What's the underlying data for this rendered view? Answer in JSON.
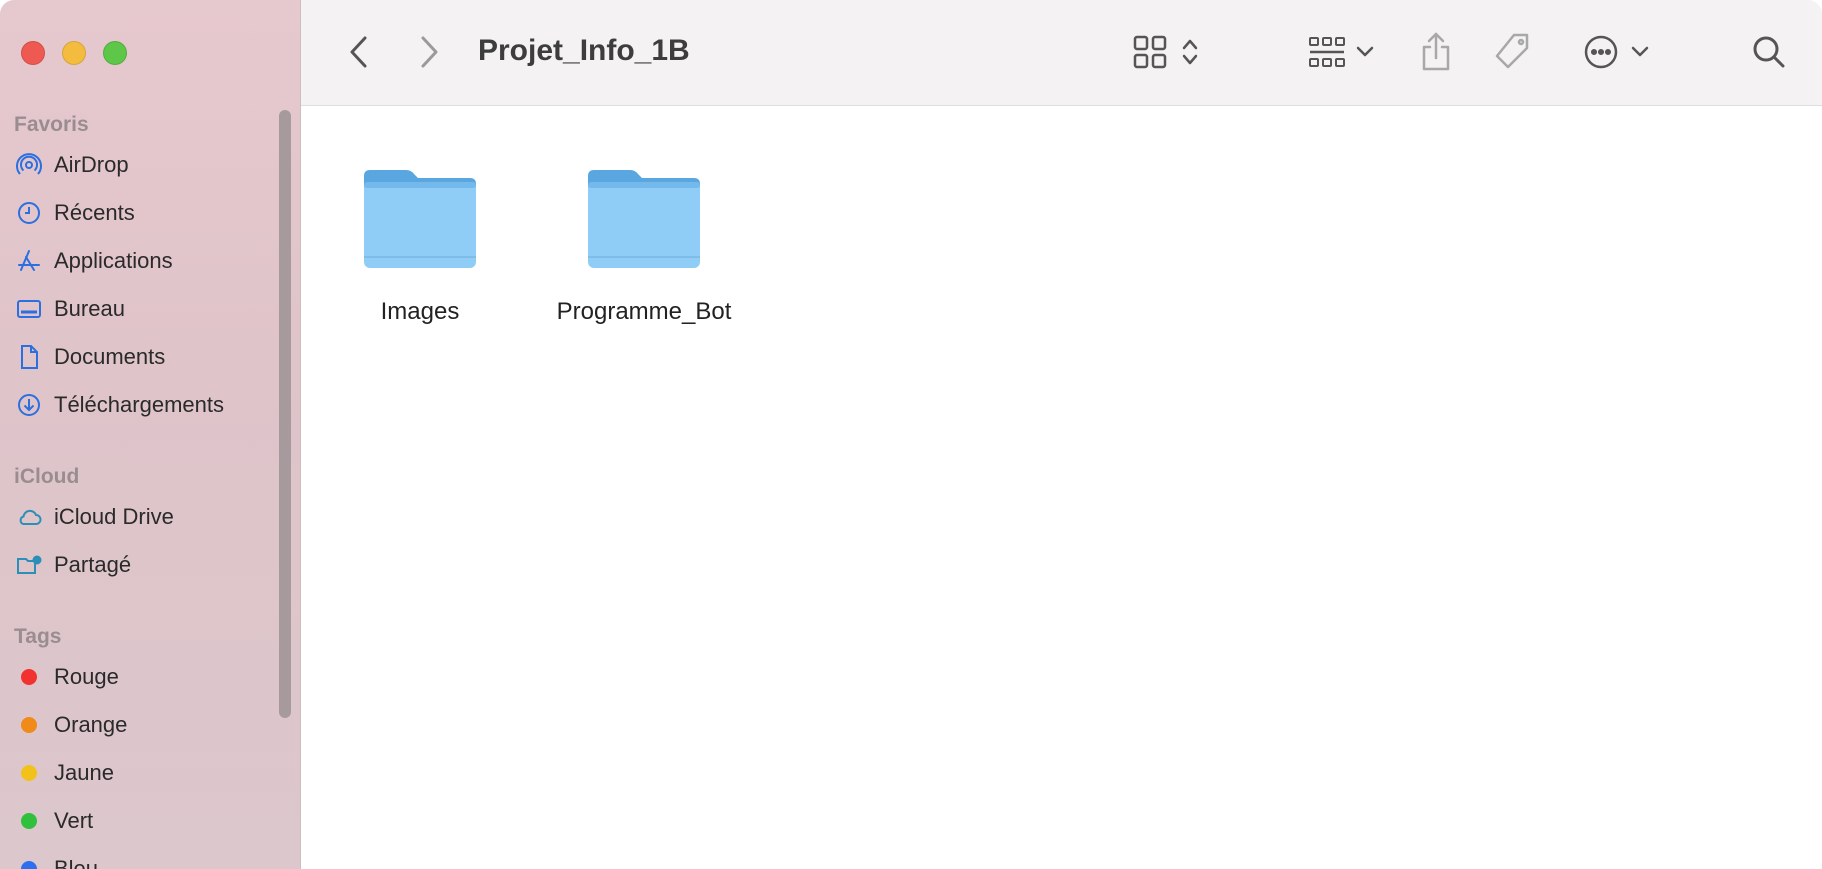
{
  "window": {
    "title": "Projet_Info_1B"
  },
  "sidebar": {
    "sections": [
      {
        "label": "Favoris"
      },
      {
        "label": "iCloud"
      },
      {
        "label": "Tags"
      }
    ],
    "favorites": [
      {
        "label": "AirDrop",
        "icon": "airdrop-icon"
      },
      {
        "label": "Récents",
        "icon": "clock-icon"
      },
      {
        "label": "Applications",
        "icon": "applications-icon"
      },
      {
        "label": "Bureau",
        "icon": "desktop-icon"
      },
      {
        "label": "Documents",
        "icon": "document-icon"
      },
      {
        "label": "Téléchargements",
        "icon": "download-icon"
      }
    ],
    "icloud": [
      {
        "label": "iCloud Drive",
        "icon": "cloud-icon"
      },
      {
        "label": "Partagé",
        "icon": "shared-folder-icon"
      }
    ],
    "tags": [
      {
        "label": "Rouge",
        "color": "#f2322e"
      },
      {
        "label": "Orange",
        "color": "#f08a18"
      },
      {
        "label": "Jaune",
        "color": "#f2c21b"
      },
      {
        "label": "Vert",
        "color": "#30c03c"
      },
      {
        "label": "Bleu",
        "color": "#2e6ff0"
      }
    ]
  },
  "toolbar": {
    "back": "chevron-left-icon",
    "forward": "chevron-right-icon",
    "view": "grid-view-icon",
    "group": "group-icon",
    "share": "share-icon",
    "tag": "tag-icon",
    "more": "more-icon",
    "search": "search-icon"
  },
  "content": {
    "items": [
      {
        "label": "Images",
        "icon": "folder-icon"
      },
      {
        "label": "Programme_Bot",
        "icon": "folder-icon"
      }
    ]
  },
  "colors": {
    "accent": "#2b6fe0",
    "folder_light": "#8fcdf6",
    "folder_dark": "#5aa6e0"
  }
}
